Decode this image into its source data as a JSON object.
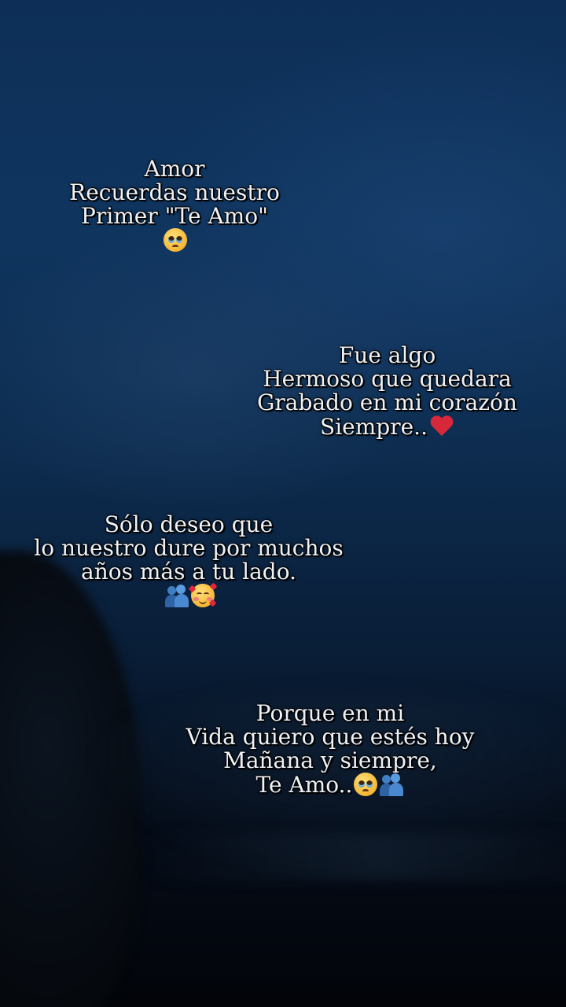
{
  "verses": [
    {
      "lines": [
        "Amor",
        "Recuerdas nuestro",
        "Primer \"Te Amo\""
      ],
      "emoji": [
        "pleading-face-icon"
      ]
    },
    {
      "lines": [
        "Fue algo",
        "Hermoso que quedara",
        "Grabado en mi corazón",
        "Siempre.."
      ],
      "emoji": [
        "red-heart-icon"
      ]
    },
    {
      "lines": [
        "Sólo deseo que",
        "lo nuestro dure por muchos",
        "años más a tu lado."
      ],
      "emoji": [
        "people-hugging-icon",
        "smiling-face-with-hearts-icon"
      ]
    },
    {
      "lines": [
        "Porque en mi",
        "Vida quiero que estés hoy",
        "Mañana y siempre,",
        "Te Amo.."
      ],
      "emoji": [
        "face-holding-back-tears-icon",
        "people-hugging-icon"
      ]
    }
  ],
  "colors": {
    "text": "#eef2f7",
    "background_top": "#0d2f57",
    "background_bottom": "#020409",
    "heart": "#d6283a"
  }
}
